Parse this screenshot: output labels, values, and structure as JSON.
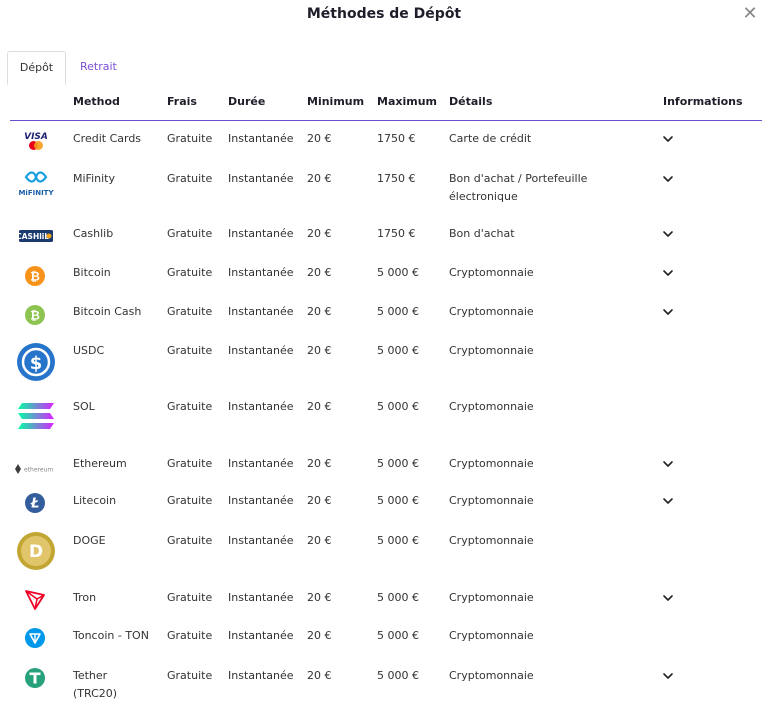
{
  "title": "Méthodes de Dépôt",
  "close_glyph": "✕",
  "tabs": [
    {
      "label": "Dépôt",
      "active": true
    },
    {
      "label": "Retrait",
      "active": false
    }
  ],
  "columns": [
    "Method",
    "Frais",
    "Durée",
    "Minimum",
    "Maximum",
    "Détails",
    "Informations"
  ],
  "rows": [
    {
      "method": "Credit Cards",
      "frais": "Gratuite",
      "duree": "Instantanée",
      "min": "20 €",
      "max": "1750 €",
      "details": "Carte de crédit",
      "info": true,
      "icon": "visa-mastercard-icon"
    },
    {
      "method": "MiFinity",
      "frais": "Gratuite",
      "duree": "Instantanée",
      "min": "20 €",
      "max": "1750 €",
      "details": "Bon d'achat / Portefeuille électronique",
      "info": true,
      "icon": "mifinity-icon",
      "logo_text": "MiFINITY"
    },
    {
      "method": "Cashlib",
      "frais": "Gratuite",
      "duree": "Instantanée",
      "min": "20 €",
      "max": "1750 €",
      "details": "Bon d'achat",
      "info": true,
      "icon": "cashlib-icon",
      "logo_text": "CASHlib"
    },
    {
      "method": "Bitcoin",
      "frais": "Gratuite",
      "duree": "Instantanée",
      "min": "20 €",
      "max": "5 000 €",
      "details": "Cryptomonnaie",
      "info": true,
      "icon": "bitcoin-icon"
    },
    {
      "method": "Bitcoin Cash",
      "frais": "Gratuite",
      "duree": "Instantanée",
      "min": "20 €",
      "max": "5 000 €",
      "details": "Cryptomonnaie",
      "info": true,
      "icon": "bitcoin-cash-icon"
    },
    {
      "method": "USDC",
      "frais": "Gratuite",
      "duree": "Instantanée",
      "min": "20 €",
      "max": "5 000 €",
      "details": "Cryptomonnaie",
      "info": false,
      "icon": "usdc-icon"
    },
    {
      "method": "SOL",
      "frais": "Gratuite",
      "duree": "Instantanée",
      "min": "20 €",
      "max": "5 000 €",
      "details": "Cryptomonnaie",
      "info": false,
      "icon": "solana-icon"
    },
    {
      "method": "Ethereum",
      "frais": "Gratuite",
      "duree": "Instantanée",
      "min": "20 €",
      "max": "5 000 €",
      "details": "Cryptomonnaie",
      "info": true,
      "icon": "ethereum-icon",
      "logo_text": "ethereum"
    },
    {
      "method": "Litecoin",
      "frais": "Gratuite",
      "duree": "Instantanée",
      "min": "20 €",
      "max": "5 000 €",
      "details": "Cryptomonnaie",
      "info": true,
      "icon": "litecoin-icon"
    },
    {
      "method": "DOGE",
      "frais": "Gratuite",
      "duree": "Instantanée",
      "min": "20 €",
      "max": "5 000 €",
      "details": "Cryptomonnaie",
      "info": false,
      "icon": "dogecoin-icon"
    },
    {
      "method": "Tron",
      "frais": "Gratuite",
      "duree": "Instantanée",
      "min": "20 €",
      "max": "5 000 €",
      "details": "Cryptomonnaie",
      "info": true,
      "icon": "tron-icon"
    },
    {
      "method": "Toncoin - TON",
      "frais": "Gratuite",
      "duree": "Instantanée",
      "min": "20 €",
      "max": "5 000 €",
      "details": "Cryptomonnaie",
      "info": false,
      "icon": "toncoin-icon"
    },
    {
      "method": "Tether (TRC20)",
      "frais": "Gratuite",
      "duree": "Instantanée",
      "min": "20 €",
      "max": "5 000 €",
      "details": "Cryptomonnaie",
      "info": true,
      "icon": "tether-icon"
    }
  ],
  "colors": {
    "accent": "#7b4fd9",
    "header_rule": "#6a4fc9",
    "bitcoin": "#f7931a",
    "bitcoin_cash": "#8dc351",
    "usdc": "#2775ca",
    "litecoin": "#345d9d",
    "tron": "#ef0027",
    "toncoin": "#0098ea",
    "tether": "#26a17b",
    "doge": "#c2a633"
  }
}
